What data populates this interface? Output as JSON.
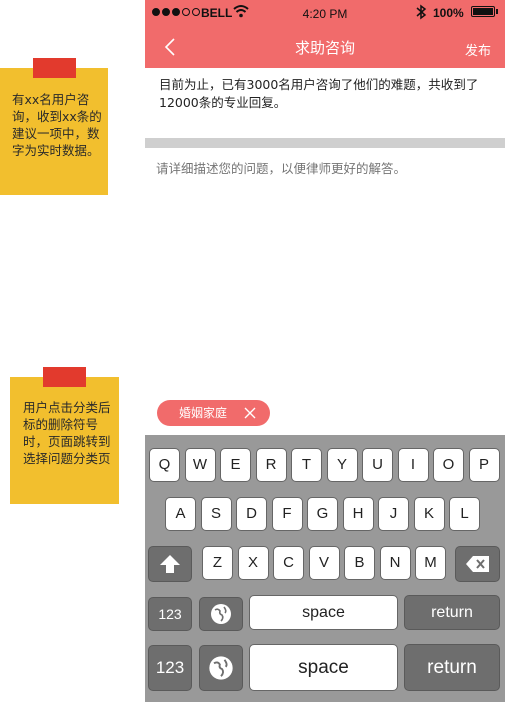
{
  "notes": [
    {
      "text": "有xx名用户咨询，收到xx条的建议一项中，数字为实时数据。"
    },
    {
      "text": "用户点击分类后标的删除符号时，页面跳转到选择问题分类页"
    }
  ],
  "status_bar": {
    "carrier": "BELL",
    "time": "4:20 PM",
    "battery": "100%"
  },
  "nav": {
    "title": "求助咨询",
    "publish_label": "发布"
  },
  "info": {
    "text": "目前为止，已有3000名用户咨询了他们的难题，共收到了12000条的专业回复。"
  },
  "question": {
    "placeholder": "请详细描述您的问题，以便律师更好的解答。"
  },
  "tag": {
    "label": "婚姻家庭"
  },
  "keyboard": {
    "row1": [
      "Q",
      "W",
      "E",
      "R",
      "T",
      "Y",
      "U",
      "I",
      "O",
      "P"
    ],
    "row2": [
      "A",
      "S",
      "D",
      "F",
      "G",
      "H",
      "J",
      "K",
      "L"
    ],
    "row3": [
      "Z",
      "X",
      "C",
      "V",
      "B",
      "N",
      "M"
    ],
    "num_label": "123",
    "space_label": "space",
    "return_label": "return"
  },
  "colors": {
    "accent": "#f16b6b",
    "note": "#f2bf2e",
    "note_tab": "#e23a2d"
  }
}
